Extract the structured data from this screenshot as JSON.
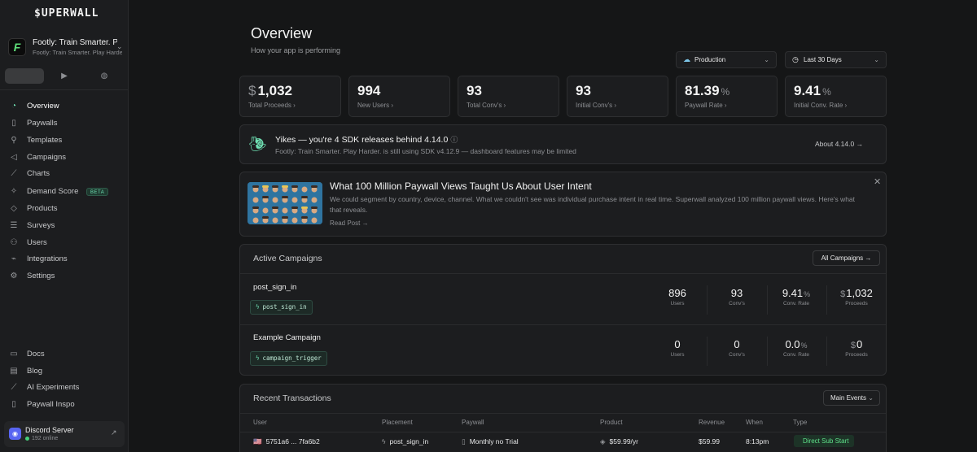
{
  "sidebar": {
    "logo": "$UPERWALL",
    "app": {
      "icon_letter": "F",
      "name": "Footly: Train Smarter. P...",
      "subtitle": "Footly: Train Smarter. Play Harder."
    },
    "platforms": [
      "apple-icon",
      "play-icon",
      "globe-icon"
    ],
    "nav": [
      {
        "label": "Overview",
        "icon": "dashboard-icon",
        "active": true
      },
      {
        "label": "Paywalls",
        "icon": "phone-icon"
      },
      {
        "label": "Templates",
        "icon": "rocket-icon"
      },
      {
        "label": "Campaigns",
        "icon": "megaphone-icon"
      },
      {
        "label": "Charts",
        "icon": "chart-icon"
      },
      {
        "label": "Demand Score",
        "icon": "sparkle-icon",
        "badge": "BETA"
      },
      {
        "label": "Products",
        "icon": "tag-icon"
      },
      {
        "label": "Surveys",
        "icon": "list-icon"
      },
      {
        "label": "Users",
        "icon": "users-icon"
      },
      {
        "label": "Integrations",
        "icon": "plug-icon"
      },
      {
        "label": "Settings",
        "icon": "gear-icon"
      }
    ],
    "footer_nav": [
      {
        "label": "Docs",
        "icon": "book-icon"
      },
      {
        "label": "Blog",
        "icon": "newspaper-icon"
      },
      {
        "label": "AI Experiments",
        "icon": "ai-icon"
      },
      {
        "label": "Paywall Inspo",
        "icon": "phone-icon"
      }
    ],
    "discord": {
      "name": "Discord Server",
      "status": "192 online"
    }
  },
  "header": {
    "title": "Overview",
    "subtitle": "How your app is performing",
    "environment": "Production",
    "range": "Last 30 Days"
  },
  "stats": [
    {
      "prefix": "$",
      "value": "1,032",
      "suffix": "",
      "label": "Total Proceeds ›"
    },
    {
      "prefix": "",
      "value": "994",
      "suffix": "",
      "label": "New Users ›"
    },
    {
      "prefix": "",
      "value": "93",
      "suffix": "",
      "label": "Total Conv's ›"
    },
    {
      "prefix": "",
      "value": "93",
      "suffix": "",
      "label": "Initial Conv's ›"
    },
    {
      "prefix": "",
      "value": "81.39",
      "suffix": "%",
      "label": "Paywall Rate ›"
    },
    {
      "prefix": "",
      "value": "9.41",
      "suffix": "%",
      "label": "Initial Conv. Rate ›"
    }
  ],
  "sdk_notice": {
    "title": "Yikes — you're 4 SDK releases behind 4.14.0",
    "message": "Footly: Train Smarter. Play Harder. is still using SDK v4.12.9 — dashboard features may be limited",
    "action": "About 4.14.0 →"
  },
  "blog_post": {
    "title": "What 100 Million Paywall Views Taught Us About User Intent",
    "body": "We could segment by country, device, channel. What we couldn't see was individual purchase intent in real time. Superwall analyzed 100 million paywall views. Here's what that reveals.",
    "read_more": "Read Post →"
  },
  "campaigns": {
    "heading": "Active Campaigns",
    "all_button": "All Campaigns →",
    "rows": [
      {
        "name": "post_sign_in",
        "trigger": "post_sign_in",
        "users": "896",
        "convs": "93",
        "rate": "9.41",
        "proceeds": "1,032"
      },
      {
        "name": "Example Campaign",
        "trigger": "campaign_trigger",
        "users": "0",
        "convs": "0",
        "rate": "0.0",
        "proceeds": "0"
      }
    ],
    "labels": {
      "users": "Users",
      "convs": "Conv's",
      "rate": "Conv. Rate",
      "proceeds": "Proceeds",
      "percent": "%",
      "currency": "$"
    }
  },
  "transactions": {
    "heading": "Recent Transactions",
    "filter": "Main Events",
    "columns": [
      "User",
      "Placement",
      "Paywall",
      "Product",
      "Revenue",
      "When",
      "Type"
    ],
    "rows": [
      {
        "flag": "🇺🇸",
        "user": "5751a6 ... 7fa6b2",
        "placement": "post_sign_in",
        "paywall": "Monthly no Trial",
        "product": "$59.99/yr",
        "revenue": "$59.99",
        "when": "8:13pm",
        "type": "Direct Sub Start"
      }
    ]
  },
  "colors": {
    "accent": "#6fe0b3",
    "background": "#151617",
    "card": "#1c1d1f",
    "success": "#5fe08a"
  }
}
